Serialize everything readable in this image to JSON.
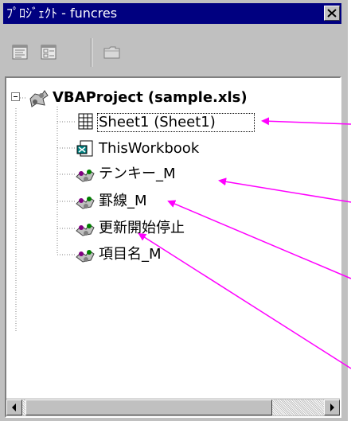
{
  "window": {
    "title": "ﾌﾟﾛｼﾞｪｸﾄ - funcres",
    "close_icon": "close-x-icon"
  },
  "toolbar": {
    "buttons": [
      {
        "name": "view-code-button",
        "icon": "code-window-icon"
      },
      {
        "name": "view-object-button",
        "icon": "form-window-icon"
      },
      {
        "name": "toggle-folders-button",
        "icon": "folder-icon"
      }
    ]
  },
  "tree": {
    "root": {
      "label": "VBAProject (sample.xls)",
      "icon": "vba-project-icon",
      "expanded": true
    },
    "items": [
      {
        "label": "Sheet1 (Sheet1)",
        "icon": "worksheet-icon"
      },
      {
        "label": "ThisWorkbook",
        "icon": "workbook-icon"
      },
      {
        "label": "テンキー_M",
        "icon": "module-icon"
      },
      {
        "label": "罫線_M",
        "icon": "module-icon"
      },
      {
        "label": "更新開始停止",
        "icon": "module-icon"
      },
      {
        "label": "項目名_M",
        "icon": "module-icon"
      }
    ]
  },
  "colors": {
    "titlebar": "#000080",
    "panel": "#c0c0c0",
    "annotation_arrow": "#ff00ff"
  }
}
